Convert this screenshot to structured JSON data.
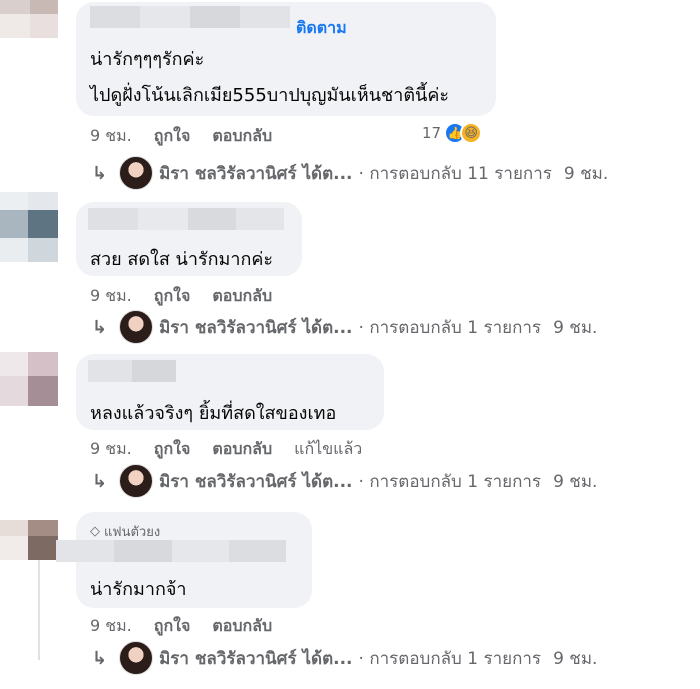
{
  "comments": [
    {
      "follow_label": "ติดตาม",
      "lines": [
        "น่ารักๆๆๆรักค่ะ",
        "ไปดูฝั่งโน้นเลิกเมีย555บาปบุญมันเห็นชาตินี้ค่ะ"
      ],
      "time": "9 ชม.",
      "like_label": "ถูกใจ",
      "reply_label": "ตอบกลับ",
      "reaction_count": "17",
      "reaction_icons": [
        "like-icon",
        "haha-icon"
      ],
      "reply_summary": {
        "author": "มิรา ชลวิรัลวานิศร์ ได้ต...",
        "text": "· การตอบกลับ 11 รายการ",
        "time": "9 ชม."
      }
    },
    {
      "lines": [
        "สวย สดใส น่ารักมากค่ะ"
      ],
      "time": "9 ชม.",
      "like_label": "ถูกใจ",
      "reply_label": "ตอบกลับ",
      "reply_summary": {
        "author": "มิรา ชลวิรัลวานิศร์ ได้ต...",
        "text": "· การตอบกลับ 1 รายการ",
        "time": "9 ชม."
      }
    },
    {
      "lines": [
        "หลงแล้วจริงๆ ยิ้มที่สดใสของเทอ"
      ],
      "time": "9 ชม.",
      "like_label": "ถูกใจ",
      "reply_label": "ตอบกลับ",
      "edited_label": "แก้ไขแล้ว",
      "reply_summary": {
        "author": "มิรา ชลวิรัลวานิศร์ ได้ต...",
        "text": "· การตอบกลับ 1 รายการ",
        "time": "9 ชม."
      }
    },
    {
      "badge": "แฟนตัวยง",
      "lines": [
        "น่ารักมากจ้า"
      ],
      "time": "9 ชม.",
      "like_label": "ถูกใจ",
      "reply_label": "ตอบกลับ",
      "reply_summary": {
        "author": "มิรา ชลวิรัลวานิศร์ ได้ต...",
        "text": "· การตอบกลับ 1 รายการ",
        "time": "9 ชม."
      }
    }
  ],
  "colors": {
    "bubble": "#f0f2f5",
    "link": "#1877f2",
    "meta": "#65676b",
    "text": "#050505"
  }
}
